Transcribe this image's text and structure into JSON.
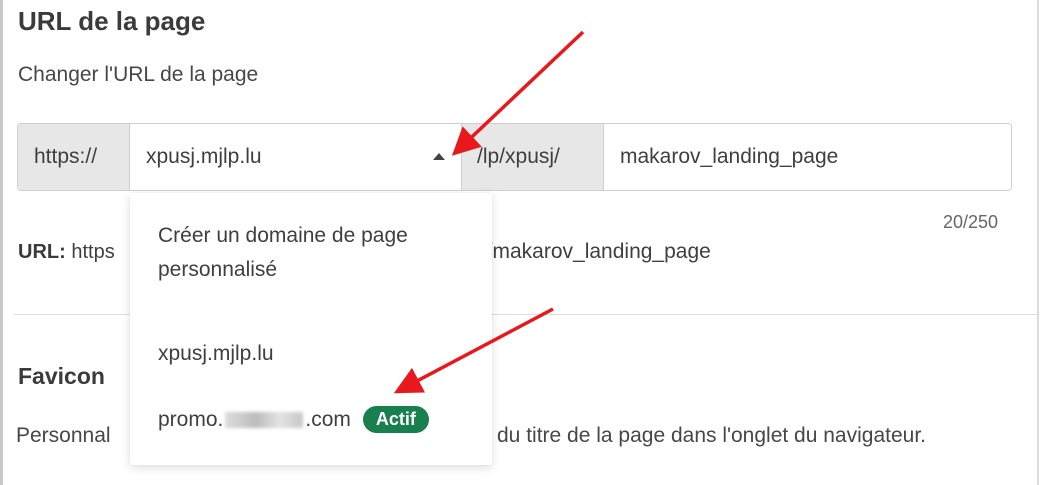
{
  "section": {
    "title": "URL de la page",
    "description": "Changer l'URL de la page"
  },
  "url_field": {
    "protocol": "https://",
    "selected_domain": "xpusj.mjlp.lu",
    "path_prefix": "/lp/xpusj/",
    "slug_value": "makarov_landing_page",
    "counter": "20/250"
  },
  "url_preview": {
    "label": "URL:",
    "value_start": "https",
    "value_end": "j/makarov_landing_page"
  },
  "dropdown": {
    "create_option": "Créer un domaine de page personnalisé",
    "options": [
      {
        "label": "xpusj.mjlp.lu"
      },
      {
        "label_prefix": "promo.",
        "label_suffix": ".com",
        "badge": "Actif"
      }
    ]
  },
  "favicon": {
    "title": "Favicon",
    "description_start": "Personnal",
    "description_end": "du titre de la page dans l'onglet du navigateur."
  },
  "colors": {
    "annotation_arrow": "#e8181d",
    "active_badge": "#1a7f4f"
  }
}
